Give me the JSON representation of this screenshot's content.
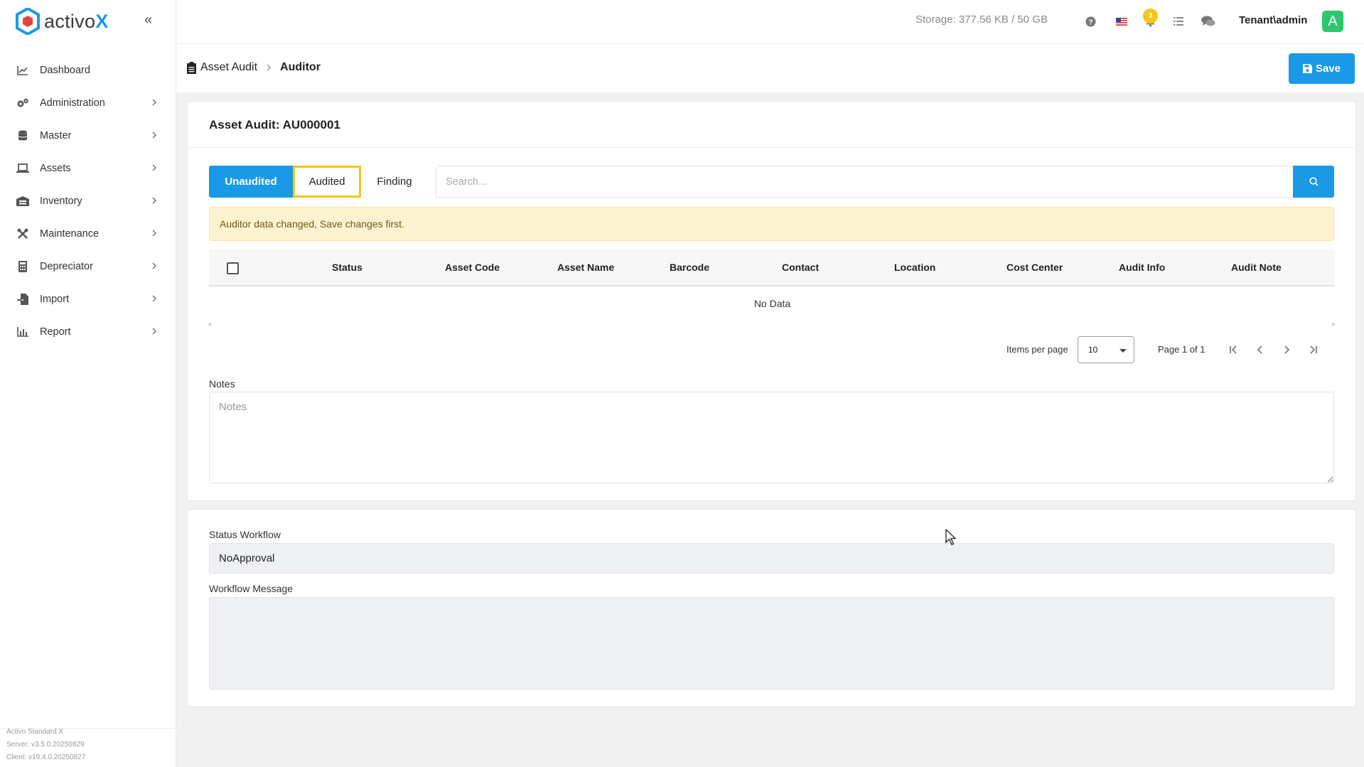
{
  "app": {
    "logo_prefix": "activo",
    "logo_suffix": "X",
    "accent_color": "#1a9ae6",
    "warning_color": "#f5c518"
  },
  "sidebar": {
    "items": [
      {
        "label": "Dashboard",
        "icon": "chart-line-icon",
        "has_submenu": false
      },
      {
        "label": "Administration",
        "icon": "gears-icon",
        "has_submenu": true
      },
      {
        "label": "Master",
        "icon": "database-icon",
        "has_submenu": true
      },
      {
        "label": "Assets",
        "icon": "laptop-icon",
        "has_submenu": true
      },
      {
        "label": "Inventory",
        "icon": "warehouse-icon",
        "has_submenu": true
      },
      {
        "label": "Maintenance",
        "icon": "tools-icon",
        "has_submenu": true
      },
      {
        "label": "Depreciator",
        "icon": "calculator-icon",
        "has_submenu": true
      },
      {
        "label": "Import",
        "icon": "file-import-icon",
        "has_submenu": true
      },
      {
        "label": "Report",
        "icon": "bar-chart-icon",
        "has_submenu": true
      }
    ],
    "version": {
      "product": "Activo Standard X",
      "server": "Server: v3.5.0.20250829",
      "client": "Client: v19.4.0.20250827"
    }
  },
  "topbar": {
    "storage": "Storage: 377.56 KB / 50 GB",
    "notification_count": "3",
    "user": "Tenant\\admin",
    "avatar_letter": "A"
  },
  "breadcrumb": {
    "parent": "Asset Audit",
    "current": "Auditor"
  },
  "toolbar": {
    "save_label": "Save"
  },
  "audit": {
    "title": "Asset Audit: AU000001",
    "tabs": [
      {
        "label": "Unaudited",
        "state": "active"
      },
      {
        "label": "Audited",
        "state": "focused"
      },
      {
        "label": "Finding",
        "state": "normal"
      }
    ],
    "search_placeholder": "Search...",
    "alert": "Auditor data changed, Save changes first.",
    "table": {
      "columns": [
        "Status",
        "Asset Code",
        "Asset Name",
        "Barcode",
        "Contact",
        "Location",
        "Cost Center",
        "Audit Info",
        "Audit Note"
      ],
      "rows": [],
      "empty_text": "No Data"
    },
    "pager": {
      "items_per_page_label": "Items per page",
      "items_per_page": "10",
      "page_info": "Page 1 of 1"
    },
    "notes_label": "Notes",
    "notes_placeholder": "Notes"
  },
  "workflow": {
    "status_label": "Status Workflow",
    "status_value": "NoApproval",
    "message_label": "Workflow Message",
    "message_value": ""
  }
}
